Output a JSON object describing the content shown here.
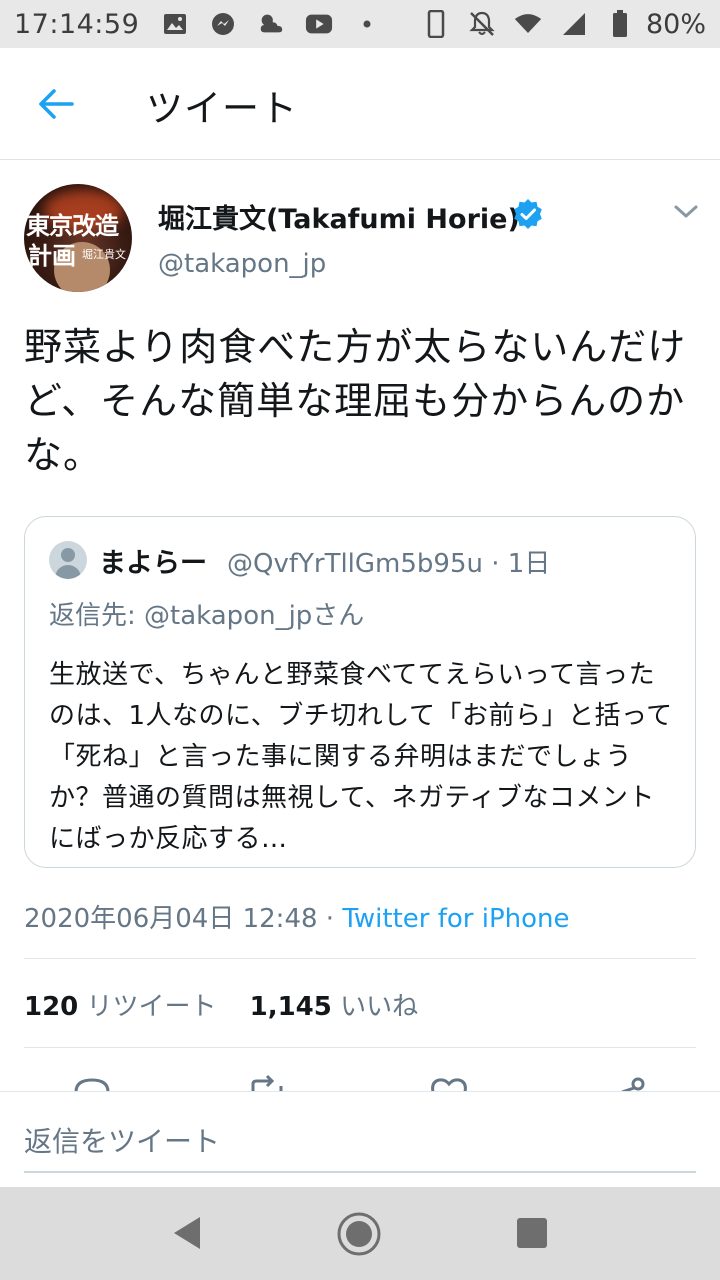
{
  "status_bar": {
    "time": "17:14:59",
    "battery": "80%",
    "icons_left": [
      "image-icon",
      "messenger-icon",
      "weather-icon",
      "youtube-icon",
      "dot-icon"
    ],
    "icons_right": [
      "vibrate-icon",
      "do-not-disturb-icon",
      "wifi-icon",
      "signal-icon",
      "battery-icon"
    ]
  },
  "appbar": {
    "title": "ツイート",
    "back_icon": "arrow-left-icon"
  },
  "tweet": {
    "author_name": "堀江貴文(Takafumi Horie)",
    "handle": "@takapon_jp",
    "verified": true,
    "avatar_text": {
      "line1": "東京改造",
      "line2": "計画",
      "small": "堀江貴文"
    },
    "text": "野菜より肉食べた方が太らないんだけど、そんな簡単な理屈も分からんのかな。",
    "timestamp": "2020年06月04日 12:48",
    "separator": " · ",
    "source": "Twitter for iPhone",
    "retweets_count": "120",
    "retweets_label": "リツイート",
    "likes_count": "1,145",
    "likes_label": "いいね"
  },
  "quoted_tweet": {
    "name": "まよらー",
    "handle_time": "@QvfYrTllGm5b95u · 1日",
    "reply_to": "返信先: @takapon_jpさん",
    "text": "生放送で、ちゃんと野菜食べててえらいって言ったのは、1人なのに、ブチ切れして「お前ら」と括って「死ね」と言った事に関する弁明はまだでしょうか？普通の質問は無視して、ネガティブなコメントにばっか反応する…"
  },
  "reply_composer": {
    "placeholder": "返信をツイート"
  },
  "colors": {
    "accent": "#1da1f2",
    "secondary_text": "#657786",
    "primary_text": "#14171a",
    "border": "#e1e8ed"
  }
}
